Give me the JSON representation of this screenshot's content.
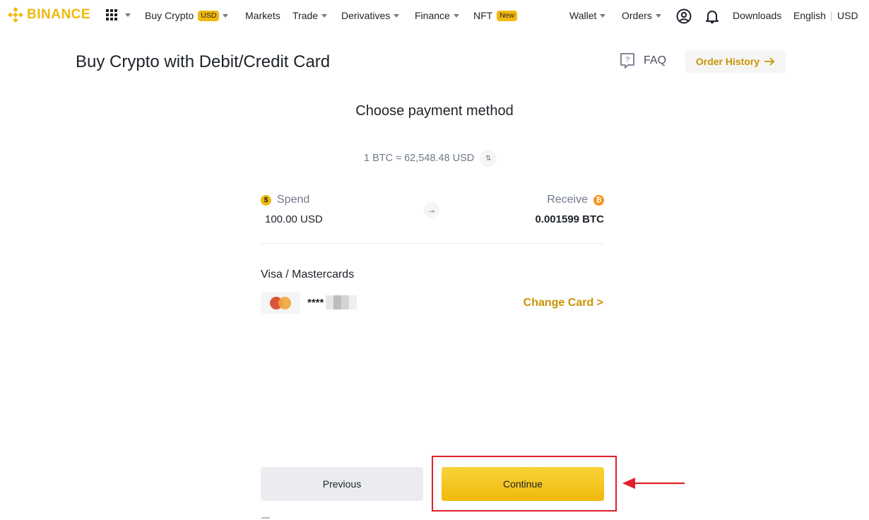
{
  "brand": {
    "name": "BINANCE",
    "color": "#f0b90b"
  },
  "nav": {
    "buy_crypto": "Buy Crypto",
    "buy_crypto_badge": "USD",
    "markets": "Markets",
    "trade": "Trade",
    "derivatives": "Derivatives",
    "finance": "Finance",
    "nft": "NFT",
    "nft_badge": "New",
    "wallet": "Wallet",
    "orders": "Orders",
    "downloads": "Downloads",
    "language": "English",
    "currency": "USD"
  },
  "header": {
    "title": "Buy Crypto with Debit/Credit Card",
    "faq": "FAQ",
    "order_history": "Order History"
  },
  "payment": {
    "section_title": "Choose payment method",
    "rate": "1 BTC ≈ 62,548.48 USD",
    "spend_label": "Spend",
    "spend_value": "100.00 USD",
    "receive_label": "Receive",
    "receive_value": "0.001599 BTC",
    "cards_label": "Visa / Mastercards",
    "card_number_prefix": "****",
    "change_card": "Change Card >"
  },
  "actions": {
    "previous": "Previous",
    "continue": "Continue"
  },
  "colors": {
    "accent": "#f0b90b",
    "link": "#c99400",
    "annotation": "#e0202a"
  }
}
